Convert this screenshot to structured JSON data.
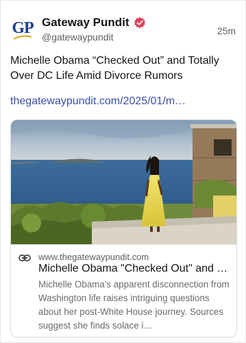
{
  "author": {
    "avatar_text": "GP",
    "display_name": "Gateway Pundit",
    "handle": "@gatewaypundit",
    "verified_icon": "verified-badge-icon",
    "brand_color": "#1d3f8c",
    "badge_color": "#e0405a"
  },
  "post": {
    "time": "25m",
    "text": "Michelle Obama “Checked Out” and Totally Over DC Life Amid Divorce Rumors",
    "link": "thegatewaypundit.com/2025/01/m…",
    "link_color": "#3a4fa8"
  },
  "card": {
    "image_alt": "woman in yellow dress on seaside terrace",
    "link_icon": "link-icon",
    "domain": "www.thegatewaypundit.com",
    "title": "Michelle Obama \"Checked Out\" and T…",
    "description": "Michelle Obama's apparent disconnection from Washington life raises intriguing questions about her post-White House journey. Sources suggest she finds solace i…"
  }
}
